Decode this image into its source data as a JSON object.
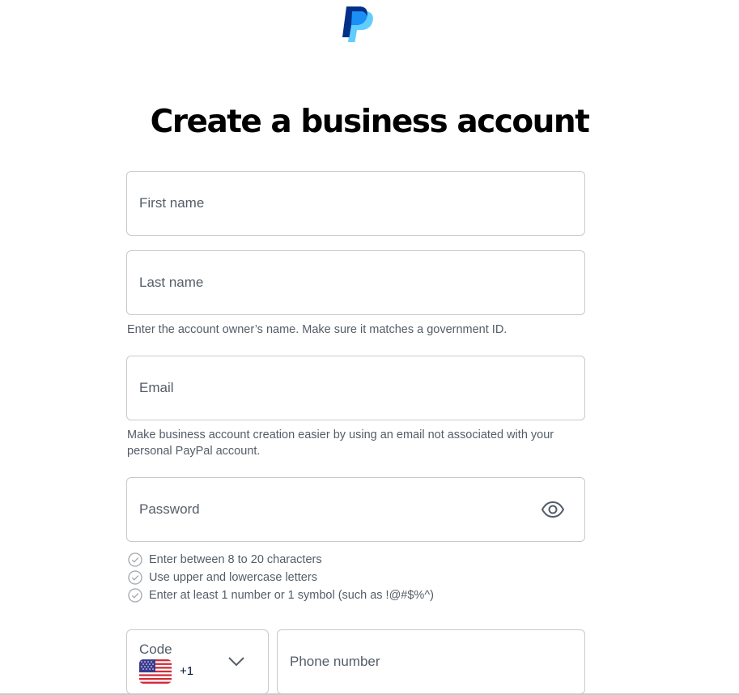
{
  "brand": {
    "logo_icon": "paypal-logo-icon",
    "colors": {
      "dark_blue": "#003087",
      "light_blue": "#1b8ff5",
      "text": "#001435",
      "muted": "#545d68",
      "border": "#c9c9cd"
    }
  },
  "page": {
    "title": "Create a business account"
  },
  "form": {
    "first_name": {
      "placeholder": "First name"
    },
    "last_name": {
      "placeholder": "Last name"
    },
    "name_helper": "Enter the account owner’s name. Make sure it matches a government ID.",
    "email": {
      "placeholder": "Email"
    },
    "email_helper": "Make business account creation easier by using an email not associated with your personal PayPal account.",
    "password": {
      "placeholder": "Password",
      "toggle_icon": "eye-icon"
    },
    "password_rules": [
      "Enter between 8 to 20 characters",
      "Use upper and lowercase letters",
      "Enter at least 1 number or 1 symbol (such as !@#$%^)"
    ],
    "phone_code": {
      "label": "Code",
      "value": "+1",
      "flag_icon": "us-flag-icon"
    },
    "phone_number": {
      "placeholder": "Phone number"
    }
  }
}
